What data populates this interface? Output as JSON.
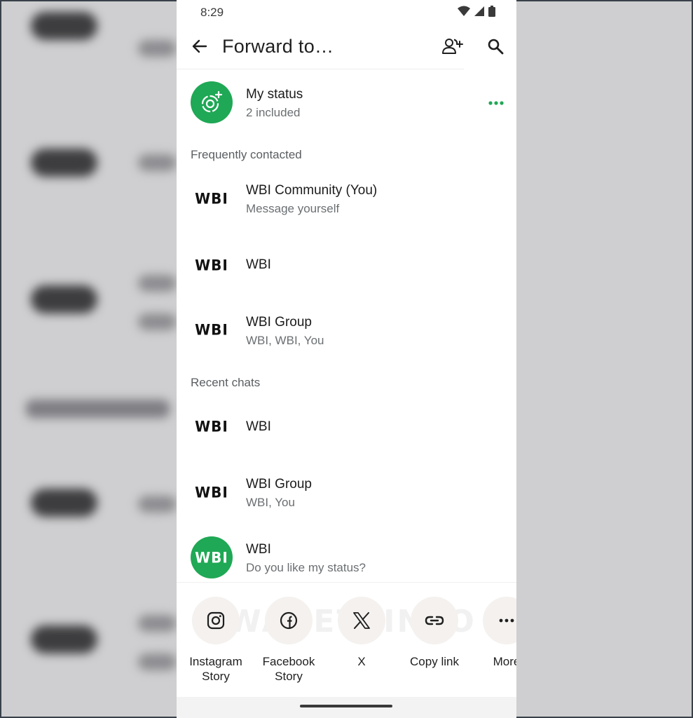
{
  "status_bar": {
    "time": "8:29"
  },
  "app_bar": {
    "title": "Forward to…"
  },
  "my_status": {
    "title": "My status",
    "subtitle": "2 included",
    "accent": "#1fa855"
  },
  "sections": {
    "frequent": "Frequently contacted",
    "recent": "Recent chats"
  },
  "frequent_contacts": [
    {
      "name": "WBI Community (You)",
      "subtitle": "Message yourself",
      "logo": "WBI"
    },
    {
      "name": "WBI",
      "subtitle": "",
      "logo": "WBI"
    },
    {
      "name": "WBI Group",
      "subtitle": "WBI, WBI, You",
      "logo": "WBI"
    }
  ],
  "recent_chats": [
    {
      "name": "WBI",
      "subtitle": "",
      "logo": "WBI"
    },
    {
      "name": "WBI Group",
      "subtitle": "WBI, You",
      "logo": "WBI"
    },
    {
      "name": "WBI",
      "subtitle": "Do you like my status?",
      "logo": "WBI"
    }
  ],
  "share_targets": [
    {
      "label": "Instagram Story",
      "icon": "instagram-icon"
    },
    {
      "label": "Facebook Story",
      "icon": "facebook-icon"
    },
    {
      "label": "X",
      "icon": "x-icon"
    },
    {
      "label": "Copy link",
      "icon": "link-icon"
    },
    {
      "label": "More",
      "icon": "more-icon"
    }
  ],
  "watermark": "WABETAINFO"
}
